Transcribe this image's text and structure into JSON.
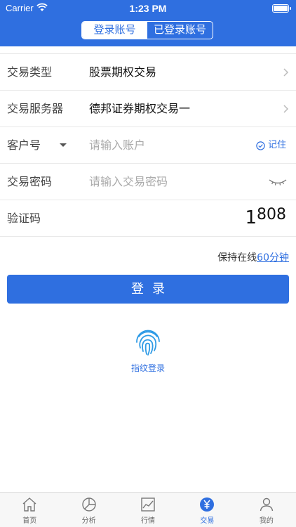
{
  "status_bar": {
    "carrier": "Carrier",
    "time": "1:23 PM"
  },
  "segmented": {
    "tabs": [
      "登录账号",
      "已登录账号"
    ],
    "active_index": 0
  },
  "form": {
    "trade_type": {
      "label": "交易类型",
      "value": "股票期权交易"
    },
    "trade_server": {
      "label": "交易服务器",
      "value": "德邦证券期权交易一"
    },
    "account": {
      "label": "客户号",
      "placeholder": "请输入账户",
      "remember_label": "记住"
    },
    "password": {
      "label": "交易密码",
      "placeholder": "请输入交易密码"
    },
    "captcha": {
      "label": "验证码",
      "code_first": "1",
      "code_rest": "808"
    }
  },
  "keep_online": {
    "prefix": "保持在线",
    "link": "60分钟"
  },
  "login_button": "登录",
  "fingerprint_label": "指纹登录",
  "tabbar": {
    "items": [
      {
        "label": "首页",
        "icon": "home-icon"
      },
      {
        "label": "分析",
        "icon": "pie-chart-icon"
      },
      {
        "label": "行情",
        "icon": "line-chart-icon"
      },
      {
        "label": "交易",
        "icon": "yen-icon"
      },
      {
        "label": "我的",
        "icon": "user-icon"
      }
    ],
    "active_index": 3
  },
  "colors": {
    "brand": "#2f6fe0"
  }
}
